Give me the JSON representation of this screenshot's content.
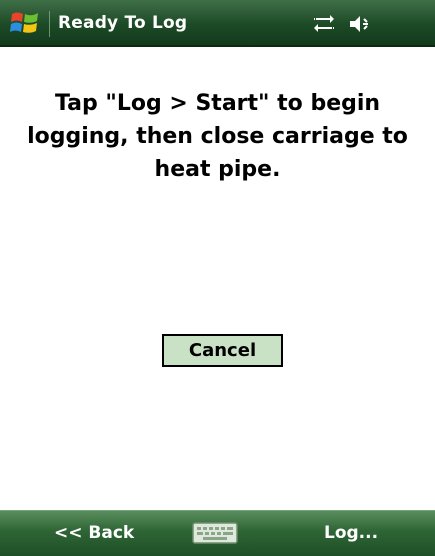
{
  "titlebar": {
    "title": "Ready To Log",
    "start_icon": "windows-start-icon",
    "connectivity_icon": "connectivity-arrows-icon",
    "volume_icon": "speaker-volume-icon"
  },
  "main": {
    "message_line1": "Tap \"Log > Start\" to begin",
    "message_line2": "logging, then close carriage to",
    "message_line3": "heat pipe.",
    "cancel_label": "Cancel"
  },
  "menubar": {
    "left_softkey": "<< Back",
    "right_softkey": "Log...",
    "keyboard_icon": "keyboard-icon"
  },
  "colors": {
    "titlebar_bg": "#1d4a26",
    "menubar_bg": "#2e6535",
    "button_bg": "#c9e2c6"
  }
}
